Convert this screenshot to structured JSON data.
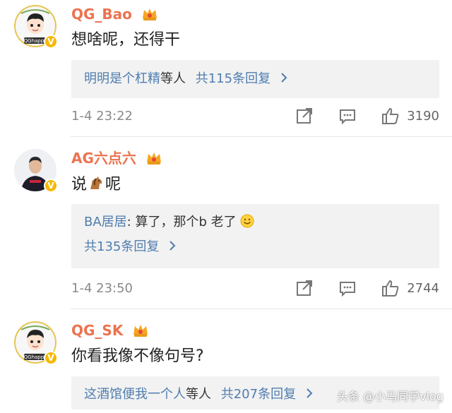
{
  "comments": [
    {
      "username": "QG_Bao",
      "text": "想啥呢，还得干",
      "reply_preview": {
        "prefix": "明明是个杠精",
        "suffix": "等人",
        "count_text": "共115条回复"
      },
      "time": "1-4 23:22",
      "likes": "3190"
    },
    {
      "username": "AG六点六",
      "text_before": "说",
      "text_after": "呢",
      "reply_preview": {
        "quote_user": "BA居居",
        "quote_text": ": 算了，那个b 老了",
        "count_text": "共135条回复"
      },
      "time": "1-4 23:50",
      "likes": "2744"
    },
    {
      "username": "QG_SK",
      "text": "你看我像不像句号?",
      "reply_preview": {
        "prefix": "这酒馆便我一个人",
        "suffix": "等人",
        "count_text": "共207条回复"
      }
    }
  ],
  "avatar_labels": {
    "qg": "QGhappy",
    "qg_banner": "生活大爆 · 战队荣耀"
  },
  "watermark": "头条 @小马同学vlog",
  "icons": [
    "crown-icon",
    "verified-icon",
    "share-icon",
    "reply-icon",
    "like-icon",
    "chevron-right-icon",
    "horse-emoji",
    "smile-emoji"
  ],
  "colors": {
    "username": "#eb7350",
    "link": "#507daf",
    "reply_bg": "#f2f2f2",
    "verified": "#f5b800"
  }
}
